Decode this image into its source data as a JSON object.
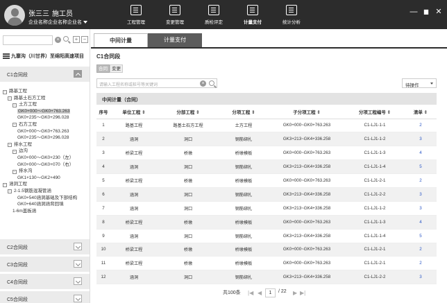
{
  "user": {
    "name": "张三三",
    "role": "施工员",
    "company": "企业名称企业名称企业名"
  },
  "nav": [
    {
      "label": "工程管理",
      "icon": "engineering-icon"
    },
    {
      "label": "变更管理",
      "icon": "change-icon"
    },
    {
      "label": "质检评定",
      "icon": "quality-icon"
    },
    {
      "label": "计量支付",
      "icon": "payment-icon"
    },
    {
      "label": "统计分析",
      "icon": "statistics-icon"
    }
  ],
  "window_controls": {
    "minimize": "—",
    "maximize": "▆",
    "close": "✕"
  },
  "sidebar": {
    "project": "九寨沟（川甘界）至绵阳高速项目",
    "sections": [
      "C1合同段",
      "C2合同段",
      "C3合同段",
      "C4合同段",
      "C5合同段"
    ],
    "tree": [
      {
        "level": 0,
        "toggle": "⊟",
        "label": "路基工程"
      },
      {
        "level": 1,
        "toggle": "⊟",
        "label": "路基土石方工程"
      },
      {
        "level": 2,
        "toggle": "⊟",
        "label": "土方工程"
      },
      {
        "level": 3,
        "toggle": "",
        "label": "GK0+000～GK0+763.263",
        "selected": true
      },
      {
        "level": 3,
        "toggle": "",
        "label": "GK0+235～GK0+296.028"
      },
      {
        "level": 2,
        "toggle": "⊟",
        "label": "石方工程"
      },
      {
        "level": 3,
        "toggle": "",
        "label": "GK0+000～GK0+763.263"
      },
      {
        "level": 3,
        "toggle": "",
        "label": "GK0+235～GK0+296.028"
      },
      {
        "level": 1,
        "toggle": "⊟",
        "label": "排水工程"
      },
      {
        "level": 2,
        "toggle": "⊟",
        "label": "边沟"
      },
      {
        "level": 3,
        "toggle": "",
        "label": "GK0+000～GK0+230（左）"
      },
      {
        "level": 3,
        "toggle": "",
        "label": "GK0+000～GK0+070（右）"
      },
      {
        "level": 2,
        "toggle": "⊟",
        "label": "排水沟"
      },
      {
        "level": 3,
        "toggle": "",
        "label": "GK1+130～GK2+490"
      },
      {
        "level": 0,
        "toggle": "⊟",
        "label": "涵洞工程"
      },
      {
        "level": 1,
        "toggle": "⊟",
        "label": "2-1.5钢筋混凝管涵"
      },
      {
        "level": 3,
        "toggle": "",
        "label": "GK0+540涵洞基础及下部结构"
      },
      {
        "level": 3,
        "toggle": "",
        "label": "GK0+640涵洞涵背回填"
      },
      {
        "level": 2,
        "toggle": "",
        "label": "1-6m盖板涵"
      }
    ]
  },
  "tabs": [
    "中间计量",
    "计量支付"
  ],
  "section_title": "C1合同段",
  "toggle_buttons": [
    "合同",
    "变更"
  ],
  "filter": {
    "placeholder": "请输入工程名称或桩号等关键词"
  },
  "action_select": "待操作",
  "table": {
    "title": "中间计量（合同）",
    "headers": [
      "序号",
      "单位工程 ⇕",
      "分部工程 ⇕",
      "分项工程 ⇕",
      "子分项工程 ⇕",
      "分项工程编号 ⇕",
      "清单 ⇕"
    ],
    "rows": [
      [
        "1",
        "路基工程",
        "路基土石方工程",
        "土方工程",
        "GK0+000~GK0+763.263",
        "C1-LJ1-1-1",
        "2"
      ],
      [
        "2",
        "涵洞",
        "洞口",
        "钢筋绑扎",
        "GK3+213~GK4+336.258",
        "C1-LJ1-1-2",
        "3"
      ],
      [
        "3",
        "桥梁工程",
        "桥墩",
        "桥墩模板",
        "GK0+000~GK0+763.263",
        "C1-LJ1-1-3",
        "4"
      ],
      [
        "4",
        "涵洞",
        "洞口",
        "钢筋绑扎",
        "GK3+213~GK4+336.258",
        "C1-LJ1-1-4",
        "5"
      ],
      [
        "5",
        "桥梁工程",
        "桥墩",
        "桥墩模板",
        "GK0+000~GK0+763.263",
        "C1-LJ1-2-1",
        "2"
      ],
      [
        "6",
        "涵洞",
        "洞口",
        "钢筋绑扎",
        "GK3+213~GK4+336.258",
        "C1-LJ1-2-2",
        "3"
      ],
      [
        "7",
        "涵洞",
        "洞口",
        "钢筋绑扎",
        "GK3+213~GK4+336.258",
        "C1-LJ1-1-2",
        "3"
      ],
      [
        "8",
        "桥梁工程",
        "桥墩",
        "桥墩模板",
        "GK0+000~GK0+763.263",
        "C1-LJ1-1-3",
        "4"
      ],
      [
        "9",
        "涵洞",
        "洞口",
        "钢筋绑扎",
        "GK3+213~GK4+336.258",
        "C1-LJ1-1-4",
        "5"
      ],
      [
        "10",
        "桥梁工程",
        "桥墩",
        "桥墩模板",
        "GK0+000~GK0+763.263",
        "C1-LJ1-2-1",
        "2"
      ],
      [
        "11",
        "桥梁工程",
        "桥墩",
        "桥墩模板",
        "GK0+000~GK0+763.263",
        "C1-LJ1-2-1",
        "2"
      ],
      [
        "12",
        "涵洞",
        "洞口",
        "钢筋绑扎",
        "GK3+213~GK4+336.258",
        "C1-LJ1-2-2",
        "3"
      ]
    ]
  },
  "pager": {
    "total": "共100条",
    "current": "1",
    "total_pages": "/ 22"
  }
}
